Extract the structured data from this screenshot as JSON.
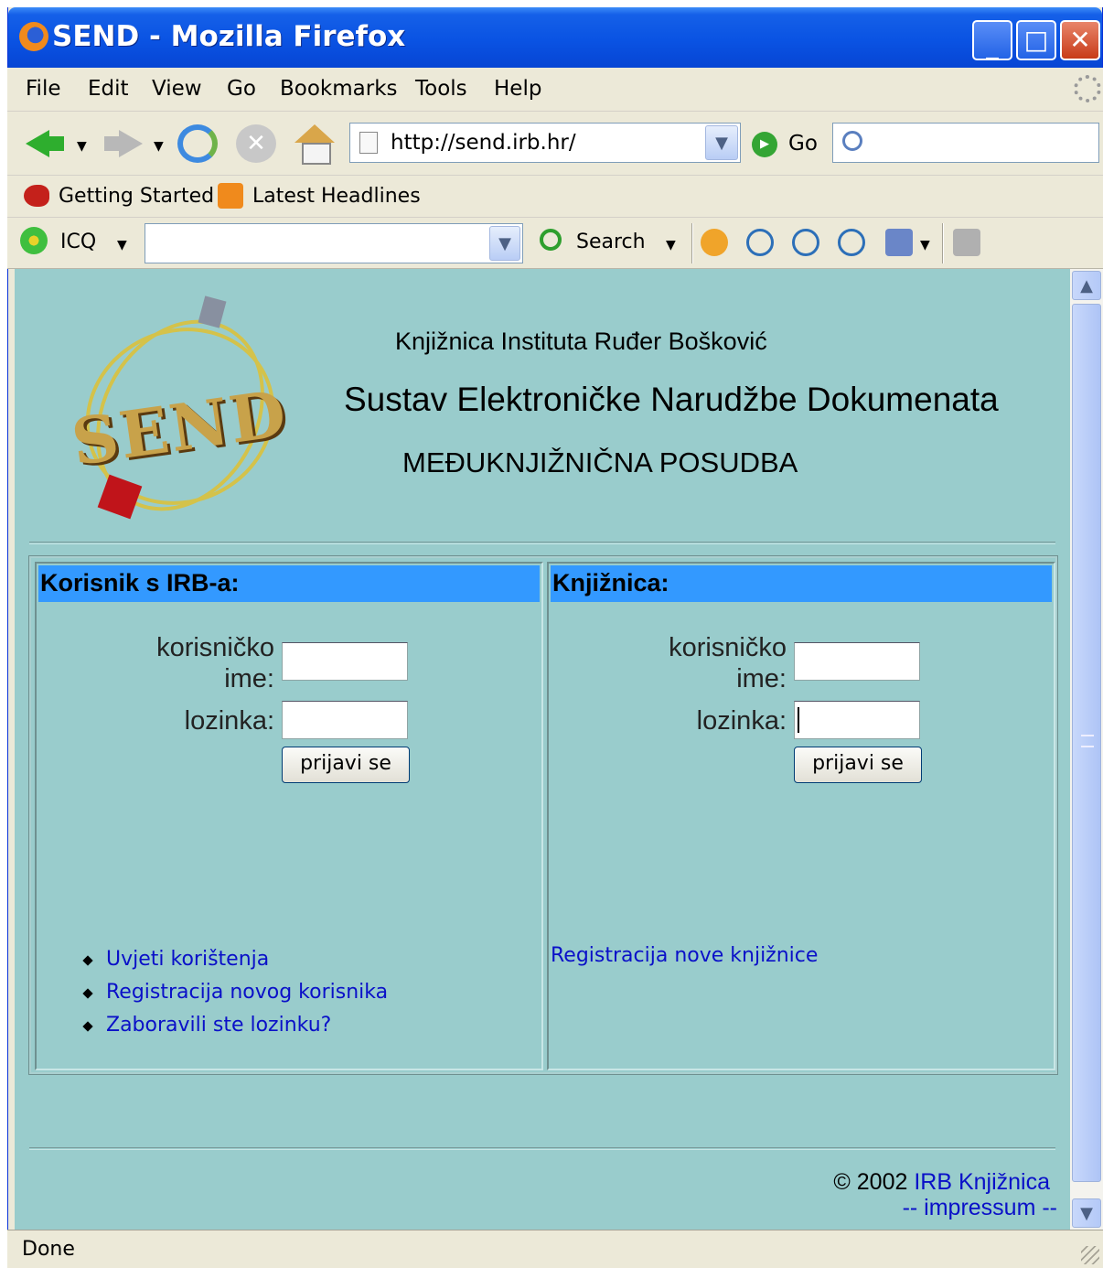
{
  "window": {
    "title": "SEND - Mozilla Firefox"
  },
  "menu": [
    "File",
    "Edit",
    "View",
    "Go",
    "Bookmarks",
    "Tools",
    "Help"
  ],
  "nav": {
    "url": "http://send.irb.hr/",
    "go_label": "Go",
    "search_value": ""
  },
  "bookmarks": [
    "Getting Started",
    "Latest Headlines"
  ],
  "icq": {
    "label": "ICQ",
    "input_value": "",
    "search_label": "Search"
  },
  "page": {
    "header_line1": "Knjižnica Instituta Ruđer Bošković",
    "header_line2": "Sustav Elektroničke Narudžbe Dokumenata",
    "header_line3": "MEĐUKNJIŽNIČNA POSUDBA",
    "logo_text": "SEND",
    "left_panel": {
      "title": "Korisnik s IRB-a:",
      "username_label_1": "korisničko",
      "username_label_2": "ime:",
      "password_label": "lozinka:",
      "button": "prijavi se",
      "links": [
        "Uvjeti korištenja",
        "Registracija novog korisnika",
        "Zaboravili ste lozinku?"
      ]
    },
    "right_panel": {
      "title": "Knjižnica:",
      "username_label_1": "korisničko",
      "username_label_2": "ime:",
      "password_label": "lozinka:",
      "button": "prijavi se",
      "link": "Registracija nove knjižnice"
    },
    "footer": {
      "copyright": "© 2002",
      "link": "IRB Knjižnica",
      "impressum": "-- impressum --"
    }
  },
  "status": "Done",
  "colors": {
    "page_bg": "#99cccc",
    "panel_header": "#3399ff",
    "link": "#0a10c8",
    "titlebar": "#0a53e3"
  }
}
